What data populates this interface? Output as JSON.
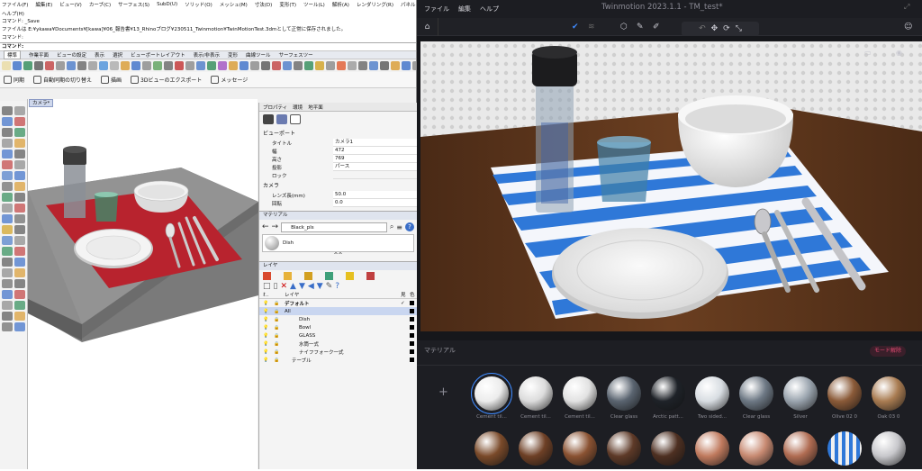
{
  "rhino": {
    "menus": [
      "ファイル(F)",
      "編集(E)",
      "ビュー(V)",
      "カーブ(C)",
      "サーフェス(S)",
      "SubD(U)",
      "ソリッド(O)",
      "メッシュ(M)",
      "寸法(D)",
      "変形(T)",
      "ツール(L)",
      "解析(A)",
      "レンダリング(R)",
      "パネル(P)"
    ],
    "help_menu": "ヘルプ(H)",
    "cmd_lines": [
      "コマンド: _Save",
      "ファイルは E:¥ykawa¥Documents¥[kawa]¥06_報告書¥13_Rhinoブログ¥230511_Twinmotion¥TwinMotionTest.3dmとして正常に保存されました。",
      "コマンド:"
    ],
    "cmd_prompt": "コマンド",
    "tabs": [
      "標準",
      "作業平面",
      "ビューの設定",
      "表示",
      "選択",
      "ビューポートレイアウト",
      "表示/非表示",
      "変形",
      "曲線ツール",
      "サーフェスツー"
    ],
    "sync": {
      "sync": "同期",
      "auto_sync": "自動同期の切り替え",
      "render": "描画",
      "export": "3Dビューのエクスポート",
      "message": "メッセージ"
    },
    "viewport_tab": "カメラ*",
    "panel_tabs": [
      "プロパティ",
      "環境",
      "地平面"
    ],
    "viewport_section": "ビューポート",
    "props": [
      {
        "k": "タイトル",
        "v": "カメラ1"
      },
      {
        "k": "幅",
        "v": "472"
      },
      {
        "k": "高さ",
        "v": "769"
      },
      {
        "k": "投影",
        "v": "パース"
      },
      {
        "k": "ロック",
        "v": ""
      }
    ],
    "camera_section": "カメラ",
    "camera_props": [
      {
        "k": "レンズ長(mm)",
        "v": "50.0"
      },
      {
        "k": "回転",
        "v": "0.0"
      }
    ],
    "material_section": "マテリアル",
    "material_search": "Black_pls",
    "material_name": "Dish",
    "layer_section": "レイヤ",
    "layer_header": "レイヤ",
    "layers": [
      {
        "name": "デフォルト",
        "indent": 0,
        "bold": true
      },
      {
        "name": "All",
        "indent": 0,
        "selected": true
      },
      {
        "name": "Dish",
        "indent": 2
      },
      {
        "name": "Bowl",
        "indent": 2
      },
      {
        "name": "GLASS",
        "indent": 2
      },
      {
        "name": "水筒一式",
        "indent": 2
      },
      {
        "name": "ナイフフォーク一式",
        "indent": 2
      },
      {
        "name": "テーブル",
        "indent": 1
      }
    ]
  },
  "tm": {
    "menus": [
      "ファイル",
      "編集",
      "ヘルプ"
    ],
    "title": "Twinmotion 2023.1.1 - TM_test*",
    "material_title": "マテリアル",
    "mode_button": "モード解除",
    "add_icon": "+",
    "materials_row1": [
      "Cement til...",
      "Cement til...",
      "Cement til...",
      "Clear glass",
      "Arctic patt...",
      "Two sided...",
      "Clear glass",
      "Silver",
      "Olive 02 0",
      "Oak 03 0"
    ],
    "colors_row1": [
      "#ececec",
      "#dcdcdc",
      "#e2e2e2",
      "#5a6470",
      "#1e2228",
      "#d8dde2",
      "#6d7884",
      "#9aa4ae",
      "#8a5a38",
      "#a97c52"
    ],
    "colors_row2": [
      "#7a4a2a",
      "#6e4026",
      "#8a5232",
      "#5e3a28",
      "#4e3022",
      "#c07a5e",
      "#c88a72",
      "#b06c52",
      "#3a78c8",
      "#c8c8cc"
    ],
    "accent": "#e0305a"
  }
}
